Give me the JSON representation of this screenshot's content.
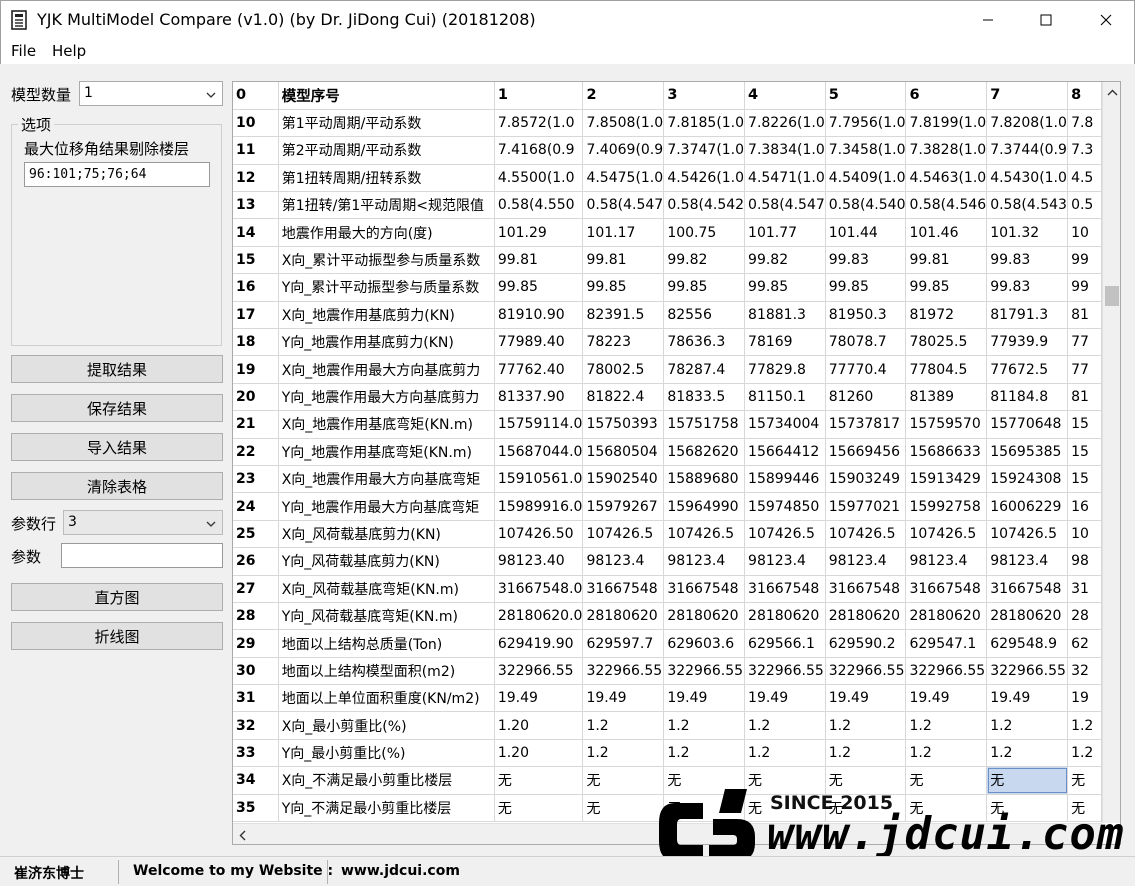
{
  "window": {
    "title": "YJK MultiModel Compare (v1.0) (by Dr. JiDong Cui) (20181208)"
  },
  "menu": [
    "File",
    "Help"
  ],
  "left_panel": {
    "model_count_label": "模型数量",
    "model_count_value": "1",
    "group_title": "选项",
    "exclude_label": "最大位移角结果剔除楼层",
    "exclude_value": "96:101;75;76;64",
    "buttons": [
      "提取结果",
      "保存结果",
      "导入结果",
      "清除表格"
    ],
    "param_row_label": "参数行",
    "param_row_value": "3",
    "param_label": "参数",
    "param_value": "",
    "chart_buttons": [
      "直方图",
      "折线图"
    ]
  },
  "grid": {
    "header": [
      "0",
      "模型序号",
      "1",
      "2",
      "3",
      "4",
      "5",
      "6",
      "7",
      "8"
    ],
    "rows": [
      [
        "10",
        "第1平动周期/平动系数",
        "7.8572(1.0",
        "7.8508(1.0",
        "7.8185(1.0",
        "7.8226(1.0",
        "7.7956(1.0",
        "7.8199(1.0",
        "7.8208(1.0",
        "7.8"
      ],
      [
        "11",
        "第2平动周期/平动系数",
        "7.4168(0.9",
        "7.4069(0.9",
        "7.3747(1.0",
        "7.3834(1.0",
        "7.3458(1.0",
        "7.3828(1.0",
        "7.3744(0.9",
        "7.3"
      ],
      [
        "12",
        "第1扭转周期/扭转系数",
        "4.5500(1.0",
        "4.5475(1.0",
        "4.5426(1.0",
        "4.5471(1.0",
        "4.5409(1.0",
        "4.5463(1.0",
        "4.5430(1.0",
        "4.5"
      ],
      [
        "13",
        "第1扭转/第1平动周期<规范限值",
        "0.58(4.550",
        "0.58(4.547",
        "0.58(4.542",
        "0.58(4.547",
        "0.58(4.540",
        "0.58(4.546",
        "0.58(4.543",
        "0.5"
      ],
      [
        "14",
        "地震作用最大的方向(度)",
        "101.29",
        "101.17",
        "100.75",
        "101.77",
        "101.44",
        "101.46",
        "101.32",
        "10"
      ],
      [
        "15",
        "X向_累计平动振型参与质量系数",
        "99.81",
        "99.81",
        "99.82",
        "99.82",
        "99.83",
        "99.81",
        "99.83",
        "99"
      ],
      [
        "16",
        "Y向_累计平动振型参与质量系数",
        "99.85",
        "99.85",
        "99.85",
        "99.85",
        "99.85",
        "99.85",
        "99.83",
        "99"
      ],
      [
        "17",
        "X向_地震作用基底剪力(KN)",
        "81910.90",
        "82391.5",
        "82556",
        "81881.3",
        "81950.3",
        "81972",
        "81791.3",
        "81"
      ],
      [
        "18",
        "Y向_地震作用基底剪力(KN)",
        "77989.40",
        "78223",
        "78636.3",
        "78169",
        "78078.7",
        "78025.5",
        "77939.9",
        "77"
      ],
      [
        "19",
        "X向_地震作用最大方向基底剪力",
        "77762.40",
        "78002.5",
        "78287.4",
        "77829.8",
        "77770.4",
        "77804.5",
        "77672.5",
        "77"
      ],
      [
        "20",
        "Y向_地震作用最大方向基底剪力",
        "81337.90",
        "81822.4",
        "81833.5",
        "81150.1",
        "81260",
        "81389",
        "81184.8",
        "81"
      ],
      [
        "21",
        "X向_地震作用基底弯矩(KN.m)",
        "15759114.0",
        "15750393",
        "15751758",
        "15734004",
        "15737817",
        "15759570",
        "15770648",
        "15"
      ],
      [
        "22",
        "Y向_地震作用基底弯矩(KN.m)",
        "15687044.0",
        "15680504",
        "15682620",
        "15664412",
        "15669456",
        "15686633",
        "15695385",
        "15"
      ],
      [
        "23",
        "X向_地震作用最大方向基底弯矩",
        "15910561.0",
        "15902540",
        "15889680",
        "15899446",
        "15903249",
        "15913429",
        "15924308",
        "15"
      ],
      [
        "24",
        "Y向_地震作用最大方向基底弯矩",
        "15989916.0",
        "15979267",
        "15964990",
        "15974850",
        "15977021",
        "15992758",
        "16006229",
        "16"
      ],
      [
        "25",
        "X向_风荷载基底剪力(KN)",
        "107426.50",
        "107426.5",
        "107426.5",
        "107426.5",
        "107426.5",
        "107426.5",
        "107426.5",
        "10"
      ],
      [
        "26",
        "Y向_风荷载基底剪力(KN)",
        "98123.40",
        "98123.4",
        "98123.4",
        "98123.4",
        "98123.4",
        "98123.4",
        "98123.4",
        "98"
      ],
      [
        "27",
        "X向_风荷载基底弯矩(KN.m)",
        "31667548.0",
        "31667548",
        "31667548",
        "31667548",
        "31667548",
        "31667548",
        "31667548",
        "31"
      ],
      [
        "28",
        "Y向_风荷载基底弯矩(KN.m)",
        "28180620.0",
        "28180620",
        "28180620",
        "28180620",
        "28180620",
        "28180620",
        "28180620",
        "28"
      ],
      [
        "29",
        "地面以上结构总质量(Ton)",
        "629419.90",
        "629597.7",
        "629603.6",
        "629566.1",
        "629590.2",
        "629547.1",
        "629548.9",
        "62"
      ],
      [
        "30",
        "地面以上结构模型面积(m2)",
        "322966.55",
        "322966.55",
        "322966.55",
        "322966.55",
        "322966.55",
        "322966.55",
        "322966.55",
        "32"
      ],
      [
        "31",
        "地面以上单位面积重度(KN/m2)",
        "19.49",
        "19.49",
        "19.49",
        "19.49",
        "19.49",
        "19.49",
        "19.49",
        "19"
      ],
      [
        "32",
        "X向_最小剪重比(%)",
        "1.20",
        "1.2",
        "1.2",
        "1.2",
        "1.2",
        "1.2",
        "1.2",
        "1.2"
      ],
      [
        "33",
        "Y向_最小剪重比(%)",
        "1.20",
        "1.2",
        "1.2",
        "1.2",
        "1.2",
        "1.2",
        "1.2",
        "1.2"
      ],
      [
        "34",
        "X向_不满足最小剪重比楼层",
        "无",
        "无",
        "无",
        "无",
        "无",
        "无",
        "无",
        "无"
      ],
      [
        "35",
        "Y向_不满足最小剪重比楼层",
        "无",
        "无",
        "无",
        "无",
        "无",
        "无",
        "无",
        "无"
      ]
    ],
    "selected_cell": {
      "row": 24,
      "col": 8
    },
    "hscroll_left_glyph": "<",
    "vscroll_up_glyph": "^"
  },
  "watermark": {
    "since": "SINCE 2015",
    "url": "www.jdcui.com"
  },
  "status": {
    "author": "崔济东博士",
    "welcome": "Welcome to my Website :",
    "site": "www.jdcui.com"
  },
  "colors": {
    "selected_cell": "#c8d8ef",
    "grid_line": "#d8d8d8",
    "button_face": "#e1e1e1"
  }
}
